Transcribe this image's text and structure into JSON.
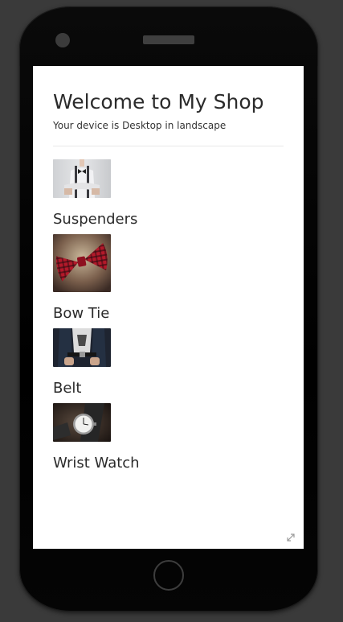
{
  "page": {
    "title": "Welcome to My Shop",
    "subtitle": "Your device is Desktop in landscape"
  },
  "products": [
    {
      "name": "Suspenders",
      "image_icon": "suspenders-photo"
    },
    {
      "name": "Bow Tie",
      "image_icon": "bow-tie-photo"
    },
    {
      "name": "Belt",
      "image_icon": "belt-photo"
    },
    {
      "name": "Wrist Watch",
      "image_icon": "wrist-watch-photo"
    }
  ],
  "colors": {
    "background": "#3a3a3a",
    "phone_body": "#000000",
    "screen": "#ffffff",
    "text": "#2b2b2b"
  }
}
